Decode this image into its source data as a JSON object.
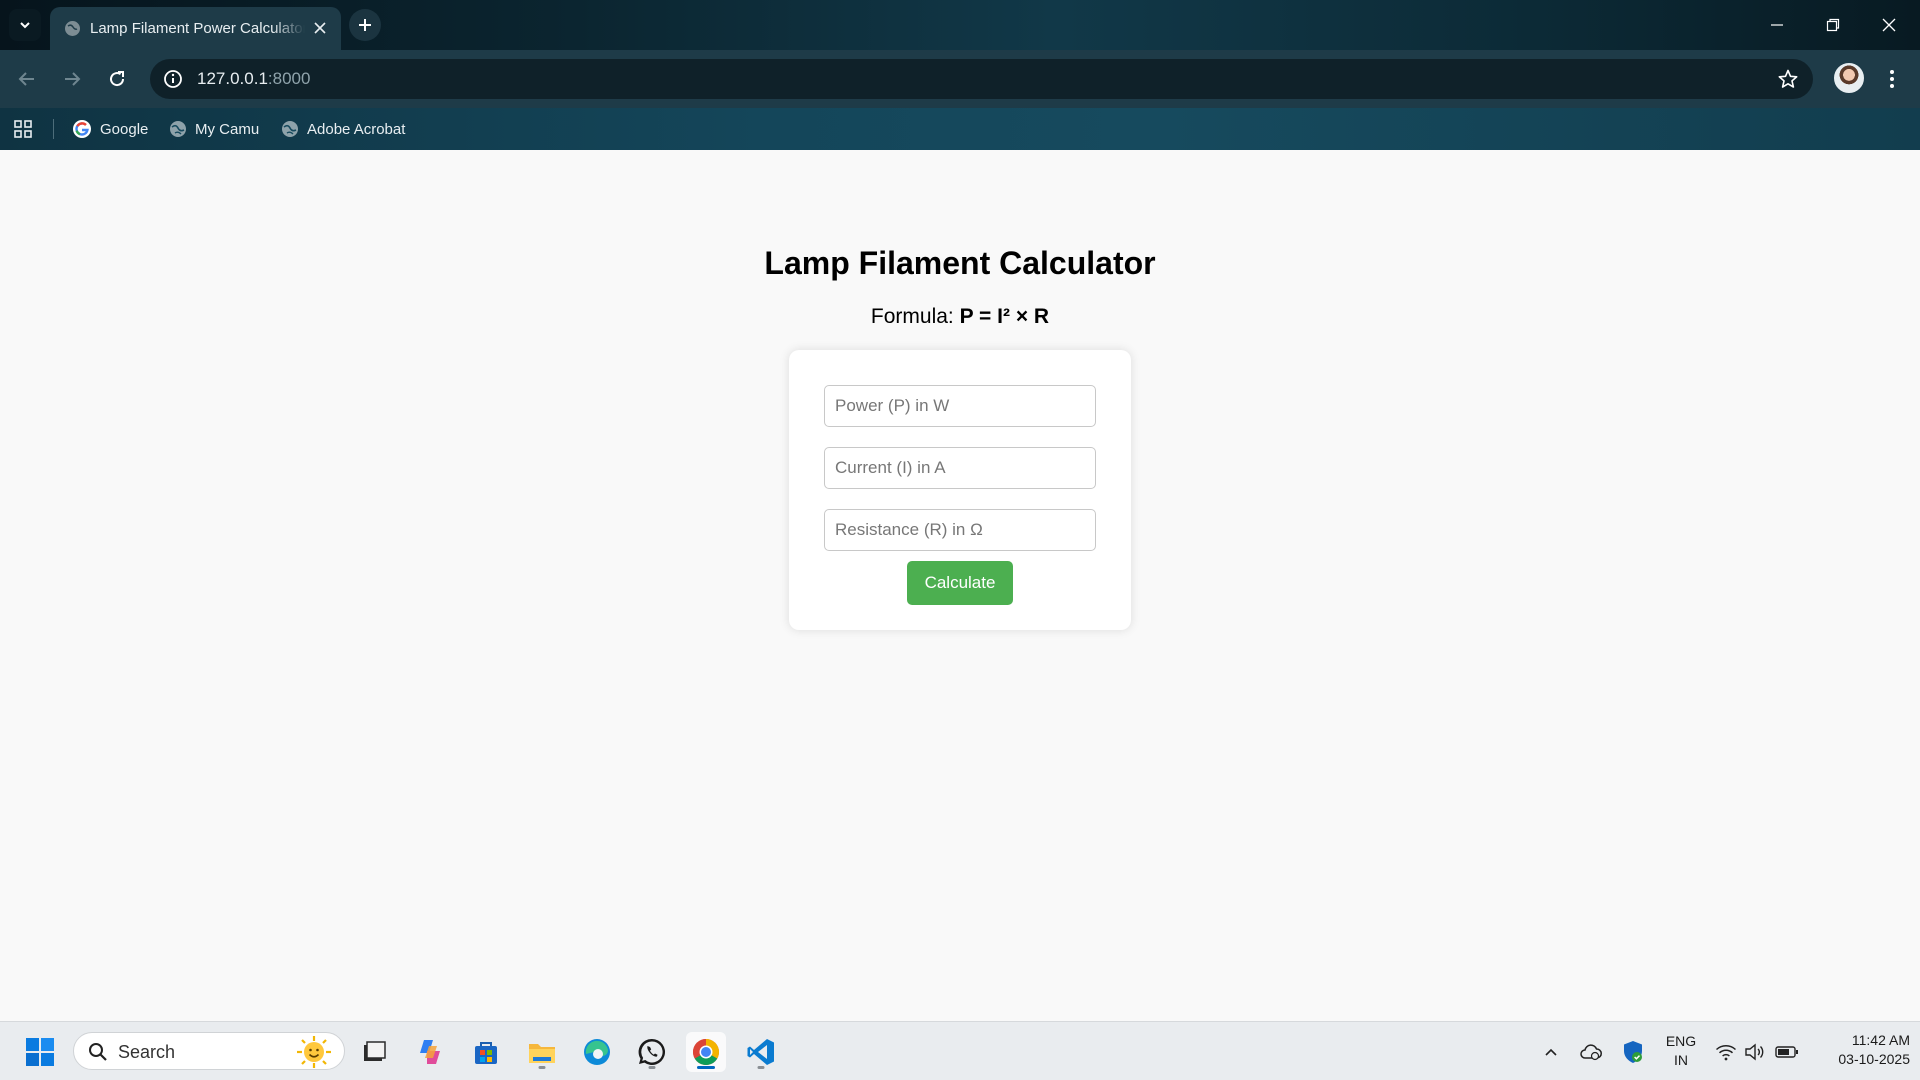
{
  "browser": {
    "tab_title": "Lamp Filament Power Calculator",
    "url_host": "127.0.0.1",
    "url_port": ":8000",
    "bookmarks": [
      {
        "label": "Google",
        "icon": "google-icon"
      },
      {
        "label": "My Camu",
        "icon": "globe-icon"
      },
      {
        "label": "Adobe Acrobat",
        "icon": "globe-icon"
      }
    ]
  },
  "page": {
    "title": "Lamp Filament Calculator",
    "formula_label": "Formula:",
    "formula": "P = I² × R",
    "inputs": {
      "power_placeholder": "Power (P) in W",
      "current_placeholder": "Current (I) in A",
      "resistance_placeholder": "Resistance (R) in Ω"
    },
    "calculate_label": "Calculate",
    "accent_color": "#4caf50"
  },
  "taskbar": {
    "search_label": "Search",
    "language": "ENG",
    "region": "IN",
    "time": "11:42 AM",
    "date": "03-10-2025"
  }
}
